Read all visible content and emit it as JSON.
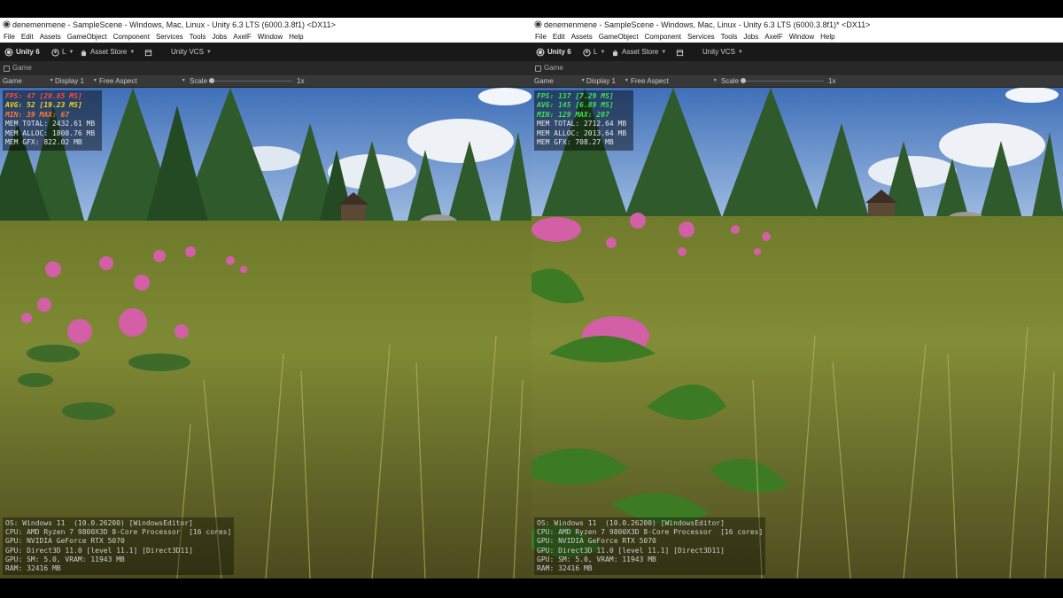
{
  "panes": [
    {
      "window_title": "denemenmene - SampleScene - Windows, Mac, Linux - Unity 6.3 LTS (6000.3.8f1) <DX11>",
      "menu": [
        "File",
        "Edit",
        "Assets",
        "GameObject",
        "Component",
        "Services",
        "Tools",
        "Jobs",
        "AxelF",
        "Window",
        "Help"
      ],
      "toolbar": {
        "brand": "Unity 6",
        "account": "L",
        "asset_store": "Asset Store",
        "vcs": "Unity VCS"
      },
      "tab_label": "Game",
      "gamebar": {
        "mode": "Game",
        "display": "Display 1",
        "aspect": "Free Aspect",
        "scale_label": "Scale",
        "scale_value": "1x"
      },
      "perf": {
        "fps": "FPS: 47 [20.85 MS]",
        "avg": "AVG: 52 [19.23 MS]",
        "minmax": "MIN: 39 MAX: 67",
        "mem_total": "MEM TOTAL: 2432.61 MB",
        "mem_alloc": "MEM ALLOC: 1808.76 MB",
        "mem_gfx": "MEM GFX: 822.02 MB",
        "colors": {
          "fps": "#ff4a3a",
          "avg": "#ffd21a",
          "minmax": "#ff7a33"
        }
      },
      "sysinfo": [
        "OS: Windows 11  (10.0.26200) [WindowsEditor]",
        "CPU: AMD Ryzen 7 9800X3D 8-Core Processor  [16 cores]",
        "GPU: NVIDIA GeForce RTX 5070",
        "GPU: Direct3D 11.0 [level 11.1] [Direct3D11]",
        "GPU: SM: 5.0, VRAM: 11943 MB",
        "RAM: 32416 MB"
      ]
    },
    {
      "window_title": "denemenmene - SampleScene - Windows, Mac, Linux - Unity 6.3 LTS (6000.3.8f1)* <DX11>",
      "menu": [
        "File",
        "Edit",
        "Assets",
        "GameObject",
        "Component",
        "Services",
        "Tools",
        "Jobs",
        "AxelF",
        "Window",
        "Help"
      ],
      "toolbar": {
        "brand": "Unity 6",
        "account": "L",
        "asset_store": "Asset Store",
        "vcs": "Unity VCS"
      },
      "tab_label": "Game",
      "gamebar": {
        "mode": "Game",
        "display": "Display 1",
        "aspect": "Free Aspect",
        "scale_label": "Scale",
        "scale_value": "1x"
      },
      "perf": {
        "fps": "FPS: 137 [7.29 MS]",
        "avg": "AVG: 145 [6.89 MS]",
        "minmax": "MIN: 129 MAX: 207",
        "mem_total": "MEM TOTAL: 2712.64 MB",
        "mem_alloc": "MEM ALLOC: 2013.64 MB",
        "mem_gfx": "MEM GFX: 708.27 MB",
        "colors": {
          "fps": "#3fe05a",
          "avg": "#3fe05a",
          "minmax": "#3fe05a"
        }
      },
      "sysinfo": [
        "OS: Windows 11  (10.0.26200) [WindowsEditor]",
        "CPU: AMD Ryzen 7 9800X3D 8-Core Processor  [16 cores]",
        "GPU: NVIDIA GeForce RTX 5070",
        "GPU: Direct3D 11.0 [level 11.1] [Direct3D11]",
        "GPU: SM: 5.0, VRAM: 11943 MB",
        "RAM: 32416 MB"
      ]
    }
  ],
  "icons": [
    "unity-logo-icon",
    "account-icon",
    "asset-store-icon",
    "package-icon",
    "chevron-down-icon",
    "game-view-icon"
  ]
}
